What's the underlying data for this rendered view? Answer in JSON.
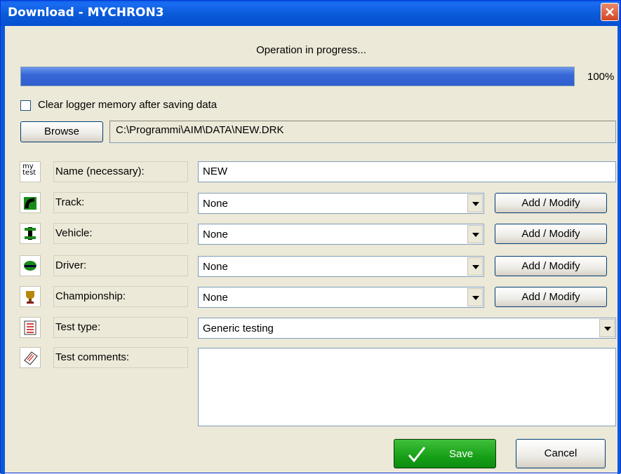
{
  "window": {
    "title": "Download - MYCHRON3"
  },
  "status": {
    "text": "Operation in progress...",
    "progress_percent": 100,
    "progress_label": "100%"
  },
  "options": {
    "clear_memory_label": "Clear logger memory after saving data",
    "clear_memory_checked": false
  },
  "browse": {
    "button_label": "Browse",
    "path": "C:\\Programmi\\AIM\\DATA\\NEW.DRK"
  },
  "form": {
    "name": {
      "label": "Name (necessary):",
      "value": "NEW",
      "icon": "my-test-icon",
      "icon_text": "my test"
    },
    "track": {
      "label": "Track:",
      "value": "None",
      "icon": "track-icon"
    },
    "vehicle": {
      "label": "Vehicle:",
      "value": "None",
      "icon": "vehicle-icon"
    },
    "driver": {
      "label": "Driver:",
      "value": "None",
      "icon": "driver-icon"
    },
    "championship": {
      "label": "Championship:",
      "value": "None",
      "icon": "trophy-icon"
    },
    "test_type": {
      "label": "Test type:",
      "value": "Generic testing",
      "icon": "checklist-icon"
    },
    "test_comments": {
      "label": "Test comments:",
      "value": "",
      "icon": "notes-icon"
    },
    "add_modify_label": "Add / Modify"
  },
  "footer": {
    "save_label": "Save",
    "cancel_label": "Cancel"
  },
  "colors": {
    "titlebar": "#0a5ad8",
    "progress": "#3868d6",
    "save_button": "#18a018",
    "close_button": "#d34524"
  }
}
